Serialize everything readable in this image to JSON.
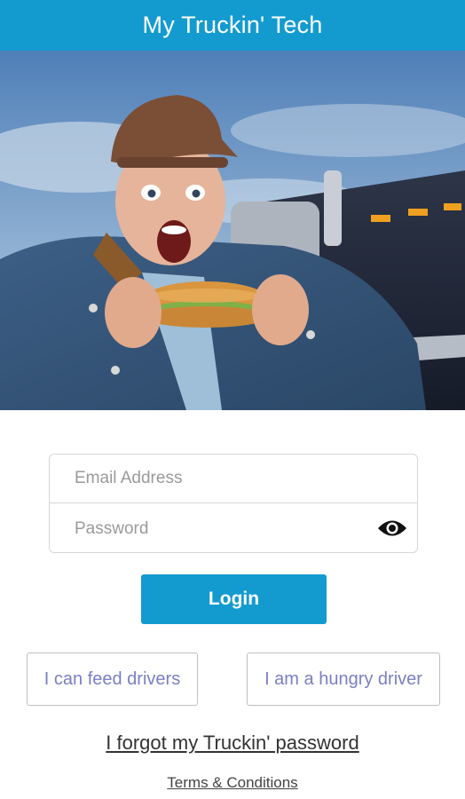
{
  "header": {
    "title": "My Truckin' Tech"
  },
  "hero": {
    "alt": "Man in denim jacket eating a sandwich in front of a truck"
  },
  "form": {
    "email_placeholder": "Email Address",
    "email_value": "",
    "password_placeholder": "Password",
    "password_value": "",
    "eye_icon": "eye-icon"
  },
  "actions": {
    "login_label": "Login",
    "feed_label": "I can feed drivers",
    "hungry_label": "I am a hungry driver",
    "forgot_label": "I forgot my Truckin' password",
    "terms_label": "Terms & Conditions"
  },
  "colors": {
    "accent": "#139bd0",
    "role_text": "#7b7fc4"
  }
}
